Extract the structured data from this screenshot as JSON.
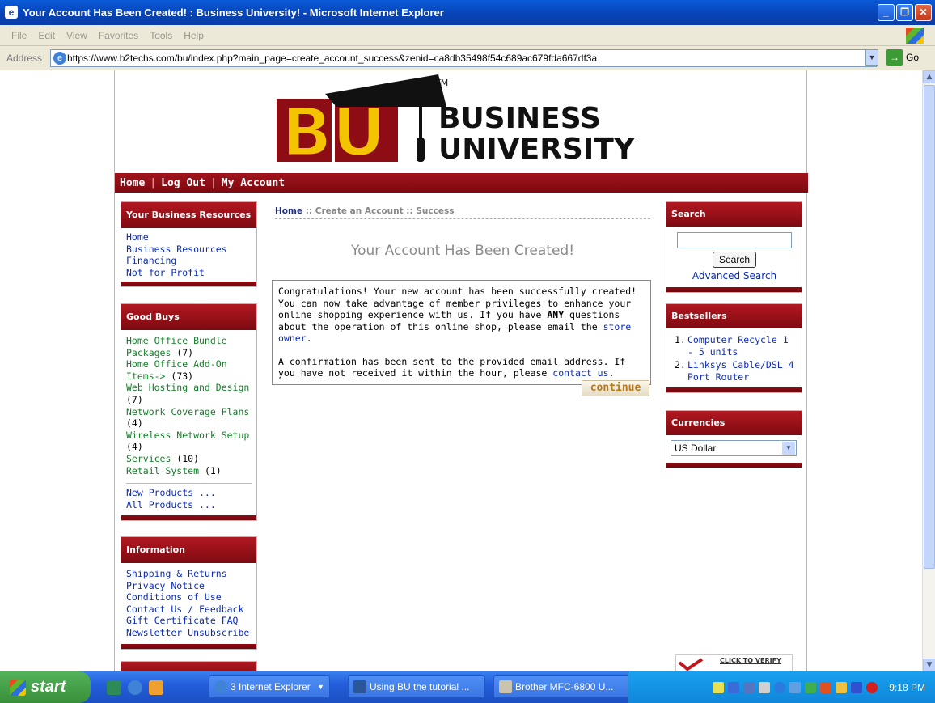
{
  "window": {
    "title": "Your Account Has Been Created! : Business University! - Microsoft Internet Explorer",
    "menu": [
      "File",
      "Edit",
      "View",
      "Favorites",
      "Tools",
      "Help"
    ],
    "address_label": "Address",
    "url": "https://www.b2techs.com/bu/index.php?main_page=create_account_success&zenid=ca8db35498f54c689ac679fda667df3a",
    "go_label": "Go"
  },
  "logo": {
    "letters": "BU",
    "line1": "BUSINESS",
    "line2": "UNIVERSITY",
    "tm": "TM"
  },
  "topnav": {
    "home": "Home",
    "logout": "Log Out",
    "account": "My Account"
  },
  "left": {
    "resources": {
      "title": "Your Business Resources",
      "links": [
        "Home",
        "Business Resources",
        "Financing",
        "Not for Profit"
      ]
    },
    "goodbuys": {
      "title": "Good Buys",
      "items": [
        {
          "name": "Home Office Bundle Packages",
          "count": "(7)"
        },
        {
          "name": "Home Office Add-On Items->",
          "count": "(73)"
        },
        {
          "name": "Web Hosting and Design",
          "count": "(7)"
        },
        {
          "name": "Network Coverage Plans",
          "count": "(4)"
        },
        {
          "name": "Wireless Network Setup",
          "count": "(4)"
        },
        {
          "name": "Services",
          "count": "(10)"
        },
        {
          "name": "Retail System",
          "count": "(1)"
        }
      ],
      "new_products": "New Products ...",
      "all_products": "All Products ..."
    },
    "information": {
      "title": "Information",
      "links": [
        "Shipping & Returns",
        "Privacy Notice",
        "Conditions of Use",
        "Contact Us / Feedback",
        "Gift Certificate FAQ",
        "Newsletter Unsubscribe"
      ]
    }
  },
  "main": {
    "breadcrumb_home": "Home",
    "breadcrumb_rest": " :: Create an Account :: Success",
    "heading": "Your Account Has Been Created!",
    "p1_a": "Congratulations! Your new account has been successfully created! You can now take advantage of member privileges to enhance your online shopping experience with us. If you have ",
    "p1_any": "ANY",
    "p1_b": " questions about the operation of this online shop, please email the ",
    "p1_link": "store owner",
    "p1_end": ".",
    "p2_a": "A confirmation has been sent to the provided email address. If you have not received it within the hour, please ",
    "p2_link": "contact us",
    "p2_end": ".",
    "continue": "continue"
  },
  "right": {
    "search": {
      "title": "Search",
      "button": "Search",
      "advanced": "Advanced Search"
    },
    "bestsellers": {
      "title": "Bestsellers",
      "items": [
        "Computer Recycle 1 - 5 units",
        "Linksys Cable/DSL 4 Port Router"
      ]
    },
    "currencies": {
      "title": "Currencies",
      "selected": "US Dollar"
    },
    "verisign": "CLICK TO VERIFY"
  },
  "taskbar": {
    "start": "start",
    "items": [
      "3 Internet Explorer",
      "Using BU the tutorial ...",
      "Brother MFC-6800 U..."
    ],
    "clock": "9:18 PM"
  },
  "colors": {
    "brand_red": "#8e0d14",
    "gold": "#f5c400",
    "link_blue": "#0b2bb8",
    "category_green": "#14802a"
  }
}
